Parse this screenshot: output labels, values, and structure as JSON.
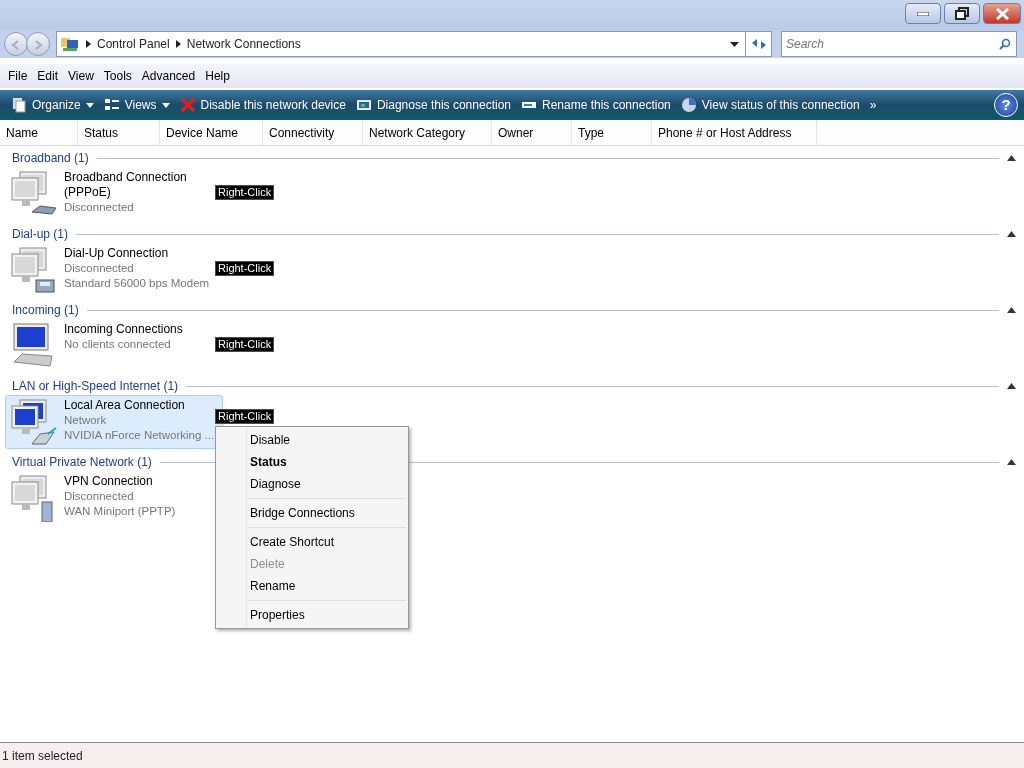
{
  "address_bar": {
    "crumbs": [
      "Control Panel",
      "Network Connections"
    ]
  },
  "search": {
    "placeholder": "Search"
  },
  "menu_bar": [
    "File",
    "Edit",
    "View",
    "Tools",
    "Advanced",
    "Help"
  ],
  "toolbar": [
    {
      "label": "Organize",
      "kind": "organize",
      "dropdown": true
    },
    {
      "label": "Views",
      "kind": "views",
      "dropdown": true
    },
    {
      "label": "Disable this network device",
      "kind": "disable",
      "dropdown": false
    },
    {
      "label": "Diagnose this connection",
      "kind": "diagnose",
      "dropdown": false
    },
    {
      "label": "Rename this connection",
      "kind": "rename",
      "dropdown": false
    },
    {
      "label": "View status of this connection",
      "kind": "status",
      "dropdown": false
    }
  ],
  "toolbar_more": "»",
  "help_button": "?",
  "columns": [
    "Name",
    "Status",
    "Device Name",
    "Connectivity",
    "Network Category",
    "Owner",
    "Type",
    "Phone # or Host Address"
  ],
  "groups": [
    {
      "title": "Broadband (1)",
      "items": [
        {
          "kind": "broadband",
          "name": "Broadband Connection (PPPoE)",
          "lines": [
            "Disconnected"
          ],
          "selected": false,
          "callout": "Right-Click"
        }
      ]
    },
    {
      "title": "Dial-up (1)",
      "items": [
        {
          "kind": "dialup",
          "name": "Dial-Up Connection",
          "lines": [
            "Disconnected",
            "Standard 56000 bps Modem"
          ],
          "selected": false,
          "callout": "Right-Click"
        }
      ]
    },
    {
      "title": "Incoming (1)",
      "items": [
        {
          "kind": "incoming",
          "name": "Incoming Connections",
          "lines": [
            "No clients connected"
          ],
          "selected": false,
          "callout": "Right-Click"
        }
      ]
    },
    {
      "title": "LAN or High-Speed Internet (1)",
      "items": [
        {
          "kind": "lan",
          "name": "Local Area Connection",
          "lines": [
            "Network",
            "NVIDIA nForce Networking ..."
          ],
          "selected": true,
          "callout": "Right-Click"
        }
      ]
    },
    {
      "title": "Virtual Private Network (1)",
      "items": [
        {
          "kind": "vpn",
          "name": "VPN Connection",
          "lines": [
            "Disconnected",
            "WAN Miniport (PPTP)"
          ],
          "selected": false
        }
      ]
    }
  ],
  "context_menu": [
    {
      "kind": "item",
      "label": "Disable",
      "default": false,
      "disabled": false
    },
    {
      "kind": "item",
      "label": "Status",
      "default": true,
      "disabled": false
    },
    {
      "kind": "item",
      "label": "Diagnose",
      "default": false,
      "disabled": false
    },
    {
      "kind": "separator"
    },
    {
      "kind": "item",
      "label": "Bridge Connections",
      "default": false,
      "disabled": false
    },
    {
      "kind": "separator"
    },
    {
      "kind": "item",
      "label": "Create Shortcut",
      "default": false,
      "disabled": false
    },
    {
      "kind": "item",
      "label": "Delete",
      "default": false,
      "disabled": true
    },
    {
      "kind": "item",
      "label": "Rename",
      "default": false,
      "disabled": false
    },
    {
      "kind": "separator"
    },
    {
      "kind": "item",
      "label": "Properties",
      "default": false,
      "disabled": false
    }
  ],
  "status_bar": "1 item selected"
}
